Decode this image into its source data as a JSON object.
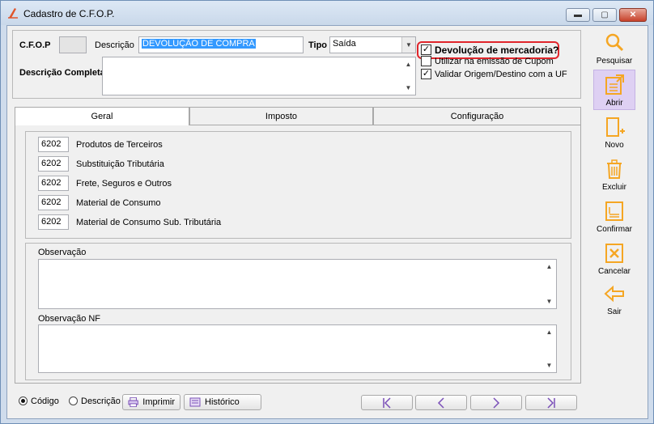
{
  "window": {
    "title": "Cadastro de C.F.O.P.",
    "controls": {
      "minimize": "▬",
      "maximize": "▢",
      "close": "✕"
    }
  },
  "header": {
    "cfop_label": "C.F.O.P",
    "cfop_value": "",
    "descricao_label": "Descrição",
    "descricao_value": "DEVOLUÇÃO DE COMPRA",
    "tipo_label": "Tipo",
    "tipo_value": "Saída",
    "descricao_completa_label": "Descrição Completa",
    "descricao_completa_value": ""
  },
  "checks": [
    {
      "label": "Devolução de mercadoria?",
      "checked": true
    },
    {
      "label": "Utilizar na emissão de Cupom",
      "checked": false
    },
    {
      "label": "Validar Origem/Destino com a UF",
      "checked": true
    }
  ],
  "tabs": [
    {
      "label": "Geral"
    },
    {
      "label": "Imposto"
    },
    {
      "label": "Configuração"
    }
  ],
  "rows": [
    {
      "code": "6202",
      "text": "Produtos de Terceiros"
    },
    {
      "code": "6202",
      "text": "Substituição Tributária"
    },
    {
      "code": "6202",
      "text": "Frete, Seguros e Outros"
    },
    {
      "code": "6202",
      "text": "Material de Consumo"
    },
    {
      "code": "6202",
      "text": "Material de Consumo Sub. Tributária"
    }
  ],
  "observacao_label": "Observação",
  "observacao_value": "",
  "observacao_nf_label": "Observação NF",
  "observacao_nf_value": "",
  "side": {
    "pesquisar": "Pesquisar",
    "abrir": "Abrir",
    "novo": "Novo",
    "excluir": "Excluir",
    "confirmar": "Confirmar",
    "cancelar": "Cancelar",
    "sair": "Sair"
  },
  "bottom": {
    "radio_codigo": "Código",
    "radio_descricao": "Descrição",
    "imprimir": "Imprimir",
    "historico": "Histórico"
  },
  "colors": {
    "accent": "#f5a623",
    "highlight_border": "#e0252b",
    "selection": "#3399ff"
  }
}
